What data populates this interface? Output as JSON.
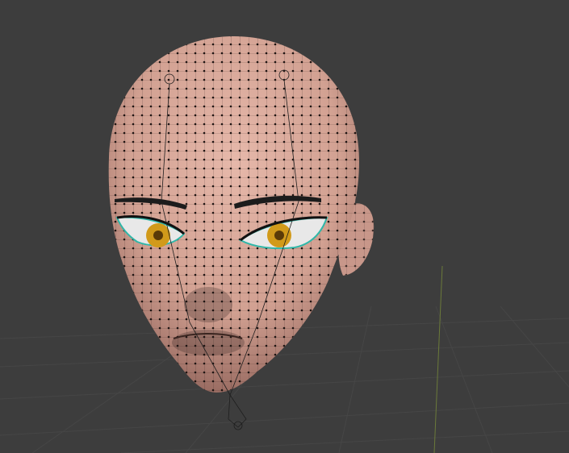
{
  "viewport": {
    "background": "#3d3d3d",
    "grid_color": "#464646",
    "axis_y_color": "#6b7a3a"
  },
  "model": {
    "skin_color": "#dcab9d",
    "skin_shadow": "#9c6e64",
    "wire_color": "#2a1c1a",
    "eye_iris_color": "#d19a1a",
    "eye_outline_color": "#2fb7a8",
    "brow_color": "#1c1c1c",
    "bone_color": "#1e1e1e"
  }
}
